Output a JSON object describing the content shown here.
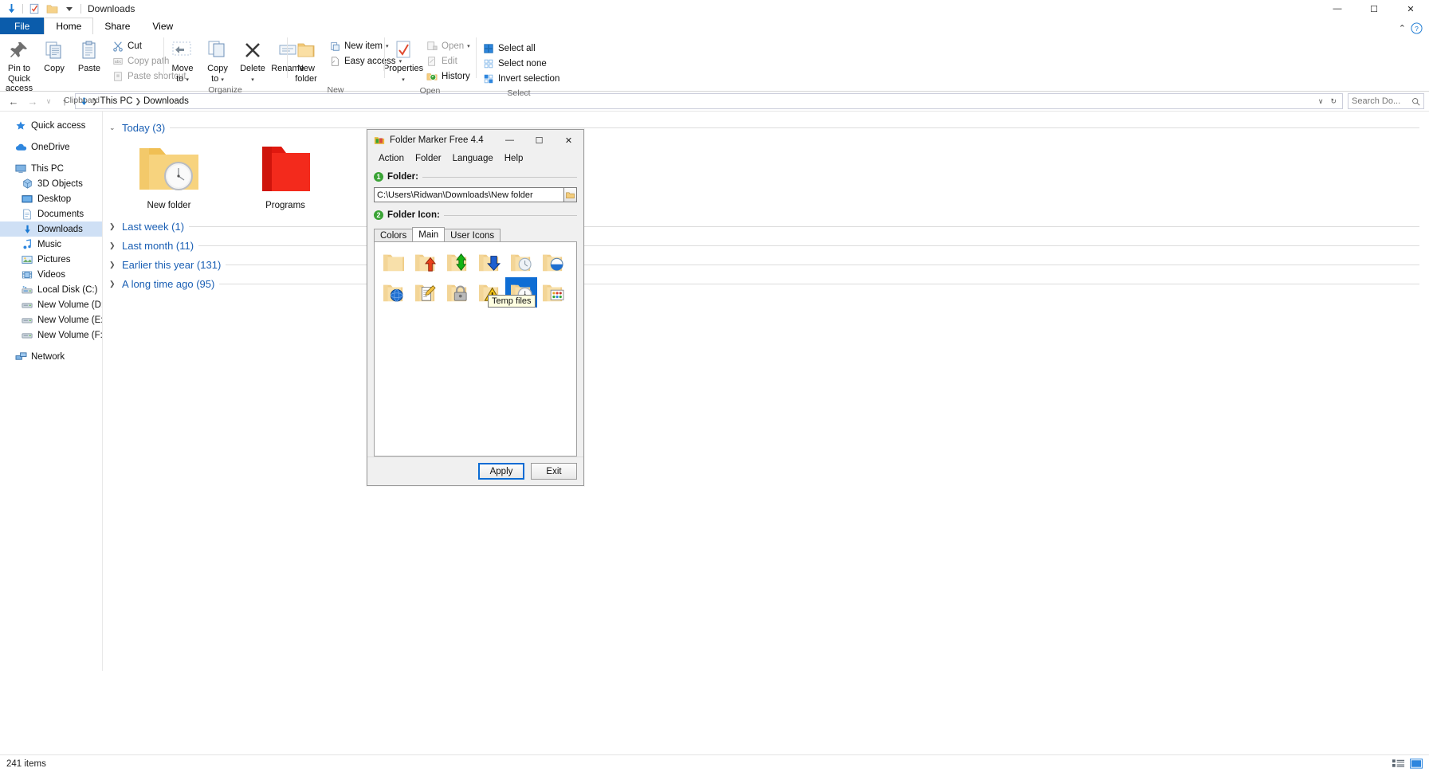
{
  "window": {
    "title": "Downloads",
    "quick_access_icons": [
      "download-arrow-icon",
      "properties-check-icon",
      "new-folder-icon",
      "customize-chevron-icon"
    ],
    "minimize": "—",
    "maximize": "☐",
    "close": "✕"
  },
  "ribbon": {
    "tabs": [
      {
        "label": "File",
        "active": false,
        "file": true
      },
      {
        "label": "Home",
        "active": true,
        "file": false
      },
      {
        "label": "Share",
        "active": false,
        "file": false
      },
      {
        "label": "View",
        "active": false,
        "file": false
      }
    ],
    "collapse_icon": "⌃",
    "help_icon": "?",
    "groups": [
      {
        "label": "Clipboard",
        "big": [
          {
            "label": "Pin to Quick\naccess",
            "icon": "pin-icon"
          },
          {
            "label": "Copy",
            "icon": "copy-icon"
          },
          {
            "label": "Paste",
            "icon": "paste-icon"
          }
        ],
        "small": [
          {
            "label": "Cut",
            "icon": "scissors-icon",
            "dim": false
          },
          {
            "label": "Copy path",
            "icon": "copy-path-icon",
            "dim": true
          },
          {
            "label": "Paste shortcut",
            "icon": "paste-shortcut-icon",
            "dim": true
          }
        ]
      },
      {
        "label": "Organize",
        "big": [
          {
            "label": "Move\nto",
            "icon": "move-to-icon",
            "caret": true
          },
          {
            "label": "Copy\nto",
            "icon": "copy-to-icon",
            "caret": true
          },
          {
            "label": "Delete",
            "icon": "delete-x-icon",
            "caret": true
          },
          {
            "label": "Rename",
            "icon": "rename-icon"
          }
        ],
        "small": []
      },
      {
        "label": "New",
        "big": [
          {
            "label": "New\nfolder",
            "icon": "new-folder-icon"
          }
        ],
        "small": [
          {
            "label": "New item",
            "icon": "new-item-icon",
            "caret": true
          },
          {
            "label": "Easy access",
            "icon": "easy-access-icon",
            "caret": true,
            "dim": false
          }
        ]
      },
      {
        "label": "Open",
        "big": [
          {
            "label": "Properties",
            "icon": "properties-icon",
            "caret": true
          }
        ],
        "small": [
          {
            "label": "Open",
            "icon": "open-icon",
            "dim": true,
            "caret": true
          },
          {
            "label": "Edit",
            "icon": "edit-icon",
            "dim": true
          },
          {
            "label": "History",
            "icon": "history-icon",
            "dim": false
          }
        ]
      },
      {
        "label": "Select",
        "big": [],
        "small": [
          {
            "label": "Select all",
            "icon": "select-all-icon"
          },
          {
            "label": "Select none",
            "icon": "select-none-icon"
          },
          {
            "label": "Invert selection",
            "icon": "invert-selection-icon"
          }
        ]
      }
    ]
  },
  "address_bar": {
    "back_icon": "←",
    "forward_icon": "→",
    "recent_icon": "∨",
    "up_icon": "↑",
    "crumbs": [
      "This PC",
      "Downloads"
    ],
    "dropdown_icon": "∨",
    "refresh_icon": "↻",
    "search_placeholder": "Search Do...",
    "search_icon": "search-icon"
  },
  "nav_pane": {
    "groups": [
      {
        "items": [
          {
            "label": "Quick access",
            "icon": "star-icon",
            "indent": false,
            "selected": false
          }
        ]
      },
      {
        "items": [
          {
            "label": "OneDrive",
            "icon": "cloud-icon",
            "indent": false,
            "selected": false
          }
        ]
      },
      {
        "items": [
          {
            "label": "This PC",
            "icon": "monitor-icon",
            "indent": false,
            "selected": false
          },
          {
            "label": "3D Objects",
            "icon": "cube-icon",
            "indent": true,
            "selected": false
          },
          {
            "label": "Desktop",
            "icon": "desktop-icon",
            "indent": true,
            "selected": false
          },
          {
            "label": "Documents",
            "icon": "documents-icon",
            "indent": true,
            "selected": false
          },
          {
            "label": "Downloads",
            "icon": "download-arrow-icon",
            "indent": true,
            "selected": true
          },
          {
            "label": "Music",
            "icon": "music-note-icon",
            "indent": true,
            "selected": false
          },
          {
            "label": "Pictures",
            "icon": "pictures-icon",
            "indent": true,
            "selected": false
          },
          {
            "label": "Videos",
            "icon": "videos-icon",
            "indent": true,
            "selected": false
          },
          {
            "label": "Local Disk (C:)",
            "icon": "local-disk-icon",
            "indent": true,
            "selected": false
          },
          {
            "label": "New Volume (D:)",
            "icon": "drive-icon",
            "indent": true,
            "selected": false
          },
          {
            "label": "New Volume (E:)",
            "icon": "drive-icon",
            "indent": true,
            "selected": false
          },
          {
            "label": "New Volume (F:)",
            "icon": "drive-icon",
            "indent": true,
            "selected": false
          }
        ]
      },
      {
        "items": [
          {
            "label": "Network",
            "icon": "network-icon",
            "indent": false,
            "selected": false
          }
        ]
      }
    ]
  },
  "content": {
    "groups": [
      {
        "header": "Today (3)",
        "expanded": true,
        "items": [
          {
            "label": "New folder",
            "icon": "folder-clock-icon"
          },
          {
            "label": "Programs",
            "icon": "folder-red-icon"
          }
        ]
      },
      {
        "header": "Last week (1)",
        "expanded": false,
        "items": []
      },
      {
        "header": "Last month (11)",
        "expanded": false,
        "items": []
      },
      {
        "header": "Earlier this year (131)",
        "expanded": false,
        "items": []
      },
      {
        "header": "A long time ago (95)",
        "expanded": false,
        "items": []
      }
    ]
  },
  "status_bar": {
    "item_count": "241 items",
    "details_view_icon": "details-view-icon",
    "large_icons_view_icon": "large-icons-view-icon"
  },
  "dialog": {
    "title": "Folder Marker Free 4.4",
    "app_icon": "folder-marker-icon",
    "minimize": "—",
    "maximize": "☐",
    "close": "✕",
    "menu": [
      "Action",
      "Folder",
      "Language",
      "Help"
    ],
    "section_folder": {
      "badge": "1",
      "label": "Folder:"
    },
    "path_value": "C:\\Users\\Ridwan\\Downloads\\New folder",
    "browse_icon": "browse-folder-icon",
    "section_icon": {
      "badge": "2",
      "label": "Folder Icon:"
    },
    "tabs": [
      {
        "label": "Colors",
        "active": false
      },
      {
        "label": "Main",
        "active": true
      },
      {
        "label": "User Icons",
        "active": false
      }
    ],
    "icons": [
      {
        "name": "folder-plain",
        "selected": false
      },
      {
        "name": "folder-red-up-arrow",
        "selected": false
      },
      {
        "name": "folder-green-updown-arrow",
        "selected": false
      },
      {
        "name": "folder-blue-down-arrow",
        "selected": false
      },
      {
        "name": "folder-clock-pale",
        "selected": false
      },
      {
        "name": "folder-half-blue-circle",
        "selected": false
      },
      {
        "name": "folder-blue-sphere",
        "selected": false
      },
      {
        "name": "folder-document-pencil",
        "selected": false
      },
      {
        "name": "folder-padlock",
        "selected": false
      },
      {
        "name": "folder-warning-triangle",
        "selected": false
      },
      {
        "name": "folder-clock-temp",
        "selected": true
      },
      {
        "name": "folder-colored-dots",
        "selected": false
      }
    ],
    "tooltip": "Temp files",
    "buttons": [
      {
        "label": "Apply",
        "primary": true
      },
      {
        "label": "Exit",
        "primary": false
      }
    ]
  },
  "colors": {
    "accent": "#0b5cab",
    "selection": "#cfe0f5",
    "group_header": "#1a5fb4",
    "badge_green": "#3aa335",
    "icon_selected": "#0e6dd4",
    "folder_yellow": "#f5c65a",
    "folder_red": "#e8231a"
  }
}
